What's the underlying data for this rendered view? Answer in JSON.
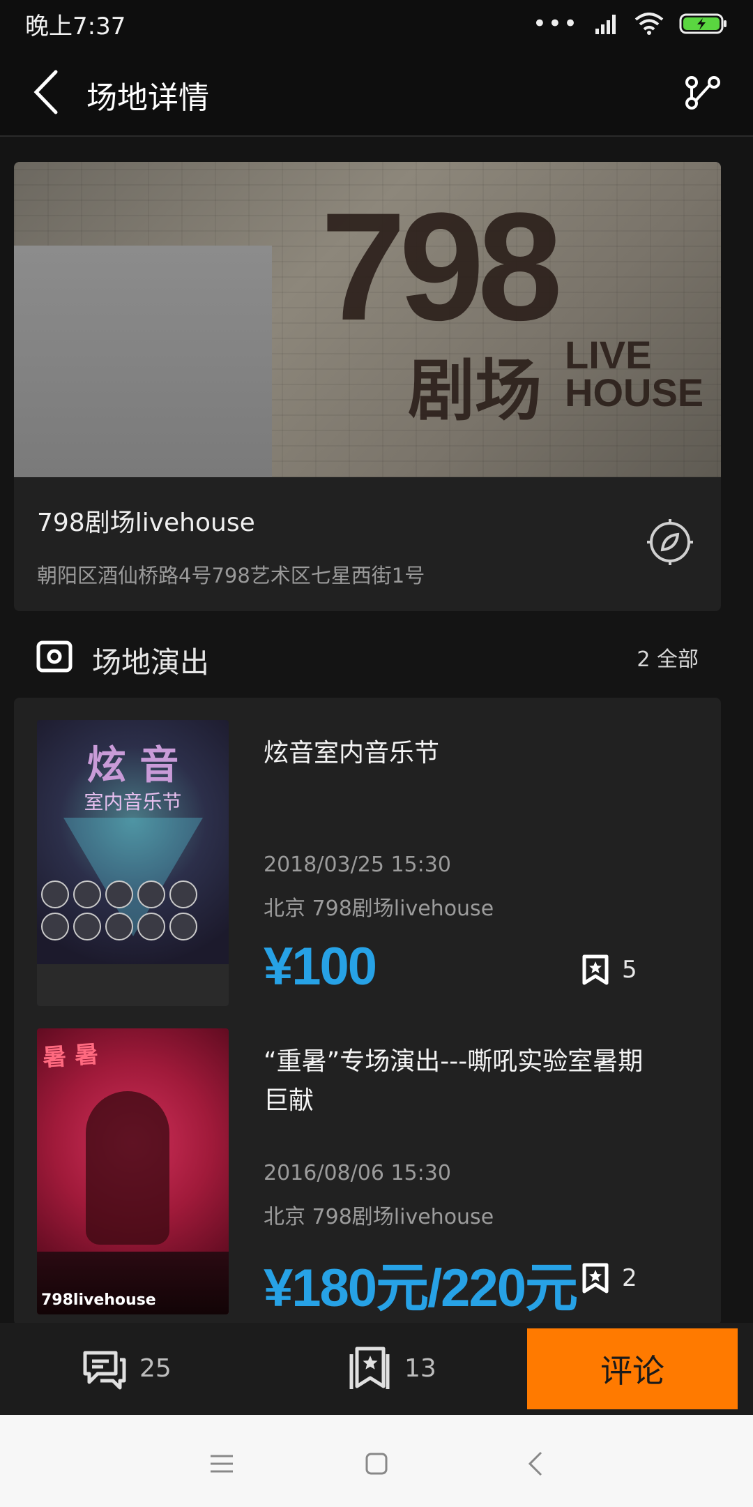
{
  "status_bar": {
    "time": "晚上7:37"
  },
  "header": {
    "title": "场地详情"
  },
  "venue": {
    "image_sign_number": "798",
    "image_sign_cn": "剧场",
    "image_sign_live": "LIVE",
    "image_sign_house": "HOUSE",
    "name": "798剧场livehouse",
    "address": "朝阳区酒仙桥路4号798艺术区七星西街1号"
  },
  "section": {
    "title": "场地演出",
    "more": "2 全部"
  },
  "shows": [
    {
      "title": "炫音室内音乐节",
      "date": "2018/03/25 15:30",
      "venue": "北京 798剧场livehouse",
      "price": "¥100",
      "favorites": "5",
      "poster_title": "炫 音",
      "poster_subtitle": "室内音乐节"
    },
    {
      "title": "“重暑”专场演出---嘶吼实验室暑期巨献",
      "date": "2016/08/06 15:30",
      "venue": "北京 798剧场livehouse",
      "price": "¥180元/220元",
      "favorites": "2",
      "poster_footer": "798livehouse"
    }
  ],
  "action_bar": {
    "comments_count": "25",
    "favorites_count": "13",
    "comment_button": "评论"
  },
  "colors": {
    "accent": "#ff7a00",
    "price": "#27a2e6",
    "background": "#141414"
  }
}
